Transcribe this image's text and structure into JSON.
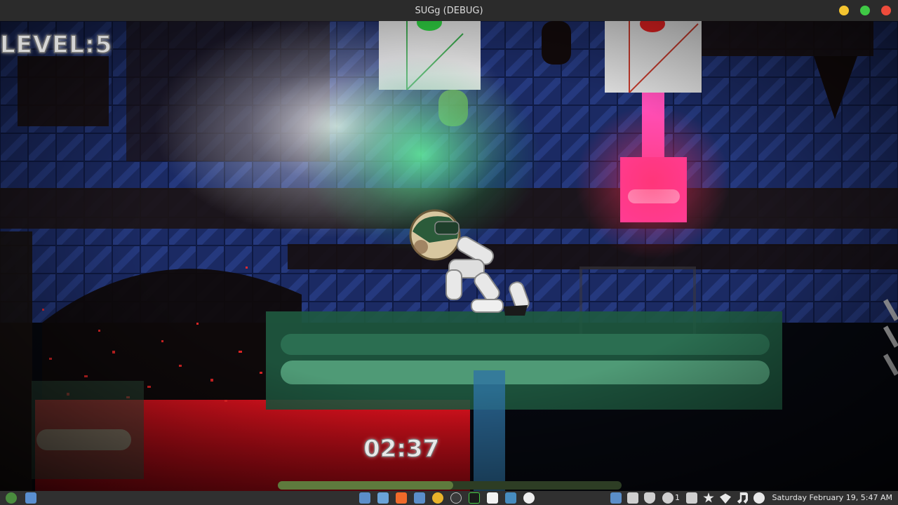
{
  "window": {
    "title": "SUGg (DEBUG)",
    "controls": {
      "minimize_color": "#f4c430",
      "maximize_color": "#3fc945",
      "close_color": "#ee4b3b"
    }
  },
  "hud": {
    "level_text": "LEVEL:5",
    "timer_text": "02:37"
  },
  "scene": {
    "lights": [
      {
        "name": "green-signal-light",
        "color": "#2ecc40"
      },
      {
        "name": "red-signal-light",
        "color": "#e02020"
      }
    ],
    "lava_color": "#c4101a",
    "platform_color": "#1f5a40",
    "laser_color": "#ff4fb8"
  },
  "taskbar": {
    "clock": "Saturday February 19,  5:47 AM",
    "notification_count": "1",
    "icons": [
      "menu-icon",
      "show-desktop-icon",
      "screenshot-icon",
      "files-icon",
      "browser-icon",
      "screenshot-icon-2",
      "chrome-icon",
      "obs-icon",
      "terminal-icon",
      "notes-icon",
      "godot-icon",
      "inkscape-icon",
      "screenshot-tray-icon",
      "clipboard-icon",
      "shield-icon",
      "notification-icon",
      "document-icon",
      "star-icon",
      "wifi-icon",
      "music-icon",
      "brightness-icon"
    ]
  }
}
